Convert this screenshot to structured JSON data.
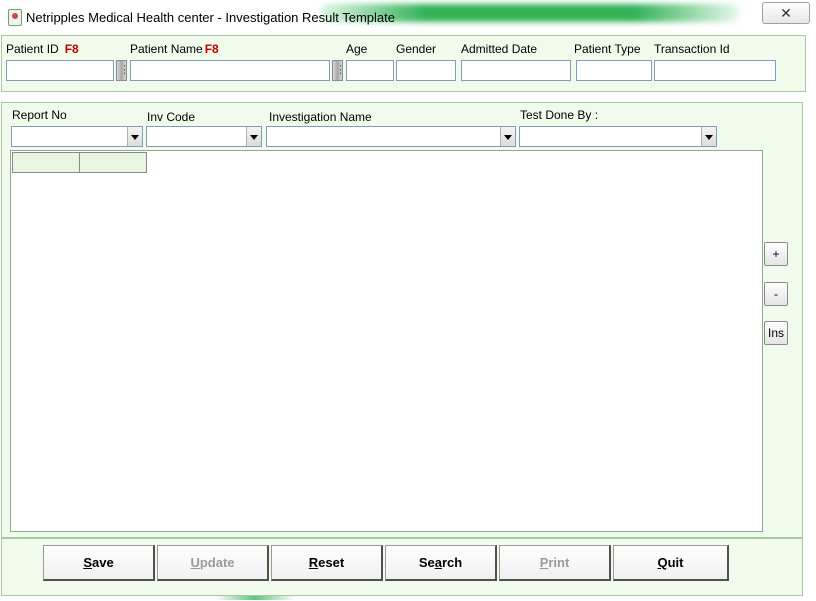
{
  "window": {
    "title": "Netripples Medical Health center  - Investigation Result Template",
    "close_symbol": "✕"
  },
  "header": {
    "patient_id_label": "Patient ID",
    "patient_id_hotkey": "F8",
    "patient_name_label": "Patient Name",
    "patient_name_hotkey": "F8",
    "age_label": "Age",
    "gender_label": "Gender",
    "admitted_date_label": "Admitted Date",
    "patient_type_label": "Patient Type",
    "transaction_id_label": "Transaction Id"
  },
  "filters": {
    "report_no_label": "Report No",
    "inv_code_label": "Inv Code",
    "investigation_name_label": "Investigation Name",
    "test_done_by_label": "Test Done By :"
  },
  "side_buttons": {
    "add": "+",
    "remove": "-",
    "insert": "Ins"
  },
  "buttons": {
    "save": {
      "mnemonic": "S",
      "rest": "ave"
    },
    "update": {
      "mnemonic": "U",
      "rest": "pdate"
    },
    "reset": {
      "mnemonic": "R",
      "rest": "eset"
    },
    "search": {
      "pre": "Se",
      "mnemonic": "a",
      "rest": "rch"
    },
    "print": {
      "mnemonic": "P",
      "rest": "rint"
    },
    "quit": {
      "mnemonic": "Q",
      "rest": "uit"
    }
  },
  "colors": {
    "panel_bg": "#f0fbeb",
    "hotkey": "#c00000",
    "title_glow": "#1eaa46"
  }
}
